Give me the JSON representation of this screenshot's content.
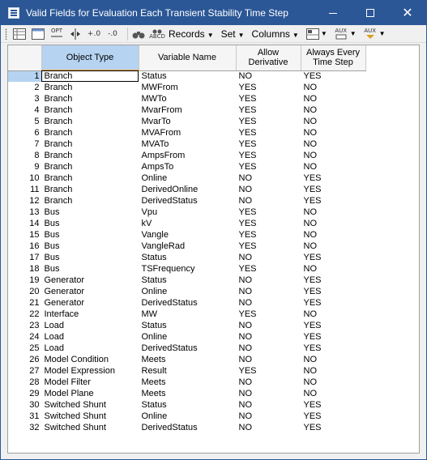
{
  "window": {
    "title": "Valid Fields for Evaluation Each Transient Stability Time Step",
    "minimize": "—",
    "maximize": "",
    "close": "✕"
  },
  "toolbar": {
    "records_label": "Records",
    "set_label": "Set",
    "columns_label": "Columns",
    "opt_label": "OPT",
    "abcd_label": "ABCD",
    "aux_label": "AUX",
    "dec_add": "+.0",
    "dec_sub": "-.0"
  },
  "table": {
    "headers": [
      "Object Type",
      "Variable Name",
      "Allow Derivative",
      "Always Every Time Step"
    ],
    "rows": [
      {
        "n": "1",
        "type": "Branch",
        "var": "Status",
        "deriv": "NO",
        "every": "YES"
      },
      {
        "n": "2",
        "type": "Branch",
        "var": "MWFrom",
        "deriv": "YES",
        "every": "NO"
      },
      {
        "n": "3",
        "type": "Branch",
        "var": "MWTo",
        "deriv": "YES",
        "every": "NO"
      },
      {
        "n": "4",
        "type": "Branch",
        "var": "MvarFrom",
        "deriv": "YES",
        "every": "NO"
      },
      {
        "n": "5",
        "type": "Branch",
        "var": "MvarTo",
        "deriv": "YES",
        "every": "NO"
      },
      {
        "n": "6",
        "type": "Branch",
        "var": "MVAFrom",
        "deriv": "YES",
        "every": "NO"
      },
      {
        "n": "7",
        "type": "Branch",
        "var": "MVATo",
        "deriv": "YES",
        "every": "NO"
      },
      {
        "n": "8",
        "type": "Branch",
        "var": "AmpsFrom",
        "deriv": "YES",
        "every": "NO"
      },
      {
        "n": "9",
        "type": "Branch",
        "var": "AmpsTo",
        "deriv": "YES",
        "every": "NO"
      },
      {
        "n": "10",
        "type": "Branch",
        "var": "Online",
        "deriv": "NO",
        "every": "YES"
      },
      {
        "n": "11",
        "type": "Branch",
        "var": "DerivedOnline",
        "deriv": "NO",
        "every": "YES"
      },
      {
        "n": "12",
        "type": "Branch",
        "var": "DerivedStatus",
        "deriv": "NO",
        "every": "YES"
      },
      {
        "n": "13",
        "type": "Bus",
        "var": "Vpu",
        "deriv": "YES",
        "every": "NO"
      },
      {
        "n": "14",
        "type": "Bus",
        "var": "kV",
        "deriv": "YES",
        "every": "NO"
      },
      {
        "n": "15",
        "type": "Bus",
        "var": "Vangle",
        "deriv": "YES",
        "every": "NO"
      },
      {
        "n": "16",
        "type": "Bus",
        "var": "VangleRad",
        "deriv": "YES",
        "every": "NO"
      },
      {
        "n": "17",
        "type": "Bus",
        "var": "Status",
        "deriv": "NO",
        "every": "YES"
      },
      {
        "n": "18",
        "type": "Bus",
        "var": "TSFrequency",
        "deriv": "YES",
        "every": "NO"
      },
      {
        "n": "19",
        "type": "Generator",
        "var": "Status",
        "deriv": "NO",
        "every": "YES"
      },
      {
        "n": "20",
        "type": "Generator",
        "var": "Online",
        "deriv": "NO",
        "every": "YES"
      },
      {
        "n": "21",
        "type": "Generator",
        "var": "DerivedStatus",
        "deriv": "NO",
        "every": "YES"
      },
      {
        "n": "22",
        "type": "Interface",
        "var": "MW",
        "deriv": "YES",
        "every": "NO"
      },
      {
        "n": "23",
        "type": "Load",
        "var": "Status",
        "deriv": "NO",
        "every": "YES"
      },
      {
        "n": "24",
        "type": "Load",
        "var": "Online",
        "deriv": "NO",
        "every": "YES"
      },
      {
        "n": "25",
        "type": "Load",
        "var": "DerivedStatus",
        "deriv": "NO",
        "every": "YES"
      },
      {
        "n": "26",
        "type": "Model Condition",
        "var": "Meets",
        "deriv": "NO",
        "every": "NO"
      },
      {
        "n": "27",
        "type": "Model Expression",
        "var": "Result",
        "deriv": "YES",
        "every": "NO"
      },
      {
        "n": "28",
        "type": "Model Filter",
        "var": "Meets",
        "deriv": "NO",
        "every": "NO"
      },
      {
        "n": "29",
        "type": "Model Plane",
        "var": "Meets",
        "deriv": "NO",
        "every": "NO"
      },
      {
        "n": "30",
        "type": "Switched Shunt",
        "var": "Status",
        "deriv": "NO",
        "every": "YES"
      },
      {
        "n": "31",
        "type": "Switched Shunt",
        "var": "Online",
        "deriv": "NO",
        "every": "YES"
      },
      {
        "n": "32",
        "type": "Switched Shunt",
        "var": "DerivedStatus",
        "deriv": "NO",
        "every": "YES"
      }
    ]
  }
}
